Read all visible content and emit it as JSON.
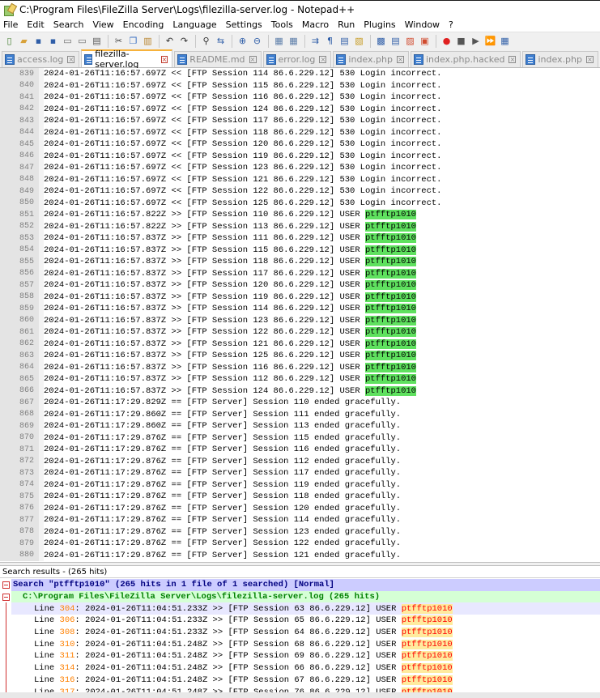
{
  "window": {
    "title": "C:\\Program Files\\FileZilla Server\\Logs\\filezilla-server.log - Notepad++"
  },
  "menu": [
    "File",
    "Edit",
    "Search",
    "View",
    "Encoding",
    "Language",
    "Settings",
    "Tools",
    "Macro",
    "Run",
    "Plugins",
    "Window",
    "?"
  ],
  "tabs": [
    {
      "label": "access.log",
      "active": false
    },
    {
      "label": "filezilla-server.log",
      "active": true
    },
    {
      "label": "README.md",
      "active": false
    },
    {
      "label": "error.log",
      "active": false
    },
    {
      "label": "index.php",
      "active": false
    },
    {
      "label": "index.php.hacked",
      "active": false
    },
    {
      "label": "index.php",
      "active": false
    }
  ],
  "editor": {
    "lines": [
      {
        "n": "839",
        "text": "2024-01-26T11:16:57.697Z << [FTP Session 114 86.6.229.12] 530 Login incorrect.",
        "hit": ""
      },
      {
        "n": "840",
        "text": "2024-01-26T11:16:57.697Z << [FTP Session 115 86.6.229.12] 530 Login incorrect.",
        "hit": ""
      },
      {
        "n": "841",
        "text": "2024-01-26T11:16:57.697Z << [FTP Session 116 86.6.229.12] 530 Login incorrect.",
        "hit": ""
      },
      {
        "n": "842",
        "text": "2024-01-26T11:16:57.697Z << [FTP Session 124 86.6.229.12] 530 Login incorrect.",
        "hit": ""
      },
      {
        "n": "843",
        "text": "2024-01-26T11:16:57.697Z << [FTP Session 117 86.6.229.12] 530 Login incorrect.",
        "hit": ""
      },
      {
        "n": "844",
        "text": "2024-01-26T11:16:57.697Z << [FTP Session 118 86.6.229.12] 530 Login incorrect.",
        "hit": ""
      },
      {
        "n": "845",
        "text": "2024-01-26T11:16:57.697Z << [FTP Session 120 86.6.229.12] 530 Login incorrect.",
        "hit": ""
      },
      {
        "n": "846",
        "text": "2024-01-26T11:16:57.697Z << [FTP Session 119 86.6.229.12] 530 Login incorrect.",
        "hit": ""
      },
      {
        "n": "847",
        "text": "2024-01-26T11:16:57.697Z << [FTP Session 123 86.6.229.12] 530 Login incorrect.",
        "hit": ""
      },
      {
        "n": "848",
        "text": "2024-01-26T11:16:57.697Z << [FTP Session 121 86.6.229.12] 530 Login incorrect.",
        "hit": ""
      },
      {
        "n": "849",
        "text": "2024-01-26T11:16:57.697Z << [FTP Session 122 86.6.229.12] 530 Login incorrect.",
        "hit": ""
      },
      {
        "n": "850",
        "text": "2024-01-26T11:16:57.697Z << [FTP Session 125 86.6.229.12] 530 Login incorrect.",
        "hit": ""
      },
      {
        "n": "851",
        "text": "2024-01-26T11:16:57.822Z >> [FTP Session 110 86.6.229.12] USER ",
        "hit": "ptfftp1010"
      },
      {
        "n": "852",
        "text": "2024-01-26T11:16:57.822Z >> [FTP Session 113 86.6.229.12] USER ",
        "hit": "ptfftp1010"
      },
      {
        "n": "853",
        "text": "2024-01-26T11:16:57.837Z >> [FTP Session 111 86.6.229.12] USER ",
        "hit": "ptfftp1010"
      },
      {
        "n": "854",
        "text": "2024-01-26T11:16:57.837Z >> [FTP Session 115 86.6.229.12] USER ",
        "hit": "ptfftp1010"
      },
      {
        "n": "855",
        "text": "2024-01-26T11:16:57.837Z >> [FTP Session 118 86.6.229.12] USER ",
        "hit": "ptfftp1010"
      },
      {
        "n": "856",
        "text": "2024-01-26T11:16:57.837Z >> [FTP Session 117 86.6.229.12] USER ",
        "hit": "ptfftp1010"
      },
      {
        "n": "857",
        "text": "2024-01-26T11:16:57.837Z >> [FTP Session 120 86.6.229.12] USER ",
        "hit": "ptfftp1010"
      },
      {
        "n": "858",
        "text": "2024-01-26T11:16:57.837Z >> [FTP Session 119 86.6.229.12] USER ",
        "hit": "ptfftp1010"
      },
      {
        "n": "859",
        "text": "2024-01-26T11:16:57.837Z >> [FTP Session 114 86.6.229.12] USER ",
        "hit": "ptfftp1010"
      },
      {
        "n": "860",
        "text": "2024-01-26T11:16:57.837Z >> [FTP Session 123 86.6.229.12] USER ",
        "hit": "ptfftp1010"
      },
      {
        "n": "861",
        "text": "2024-01-26T11:16:57.837Z >> [FTP Session 122 86.6.229.12] USER ",
        "hit": "ptfftp1010"
      },
      {
        "n": "862",
        "text": "2024-01-26T11:16:57.837Z >> [FTP Session 121 86.6.229.12] USER ",
        "hit": "ptfftp1010"
      },
      {
        "n": "863",
        "text": "2024-01-26T11:16:57.837Z >> [FTP Session 125 86.6.229.12] USER ",
        "hit": "ptfftp1010"
      },
      {
        "n": "864",
        "text": "2024-01-26T11:16:57.837Z >> [FTP Session 116 86.6.229.12] USER ",
        "hit": "ptfftp1010"
      },
      {
        "n": "865",
        "text": "2024-01-26T11:16:57.837Z >> [FTP Session 112 86.6.229.12] USER ",
        "hit": "ptfftp1010"
      },
      {
        "n": "866",
        "text": "2024-01-26T11:16:57.837Z >> [FTP Session 124 86.6.229.12] USER ",
        "hit": "ptfftp1010"
      },
      {
        "n": "867",
        "text": "2024-01-26T11:17:29.829Z == [FTP Server] Session 110 ended gracefully.",
        "hit": ""
      },
      {
        "n": "868",
        "text": "2024-01-26T11:17:29.860Z == [FTP Server] Session 111 ended gracefully.",
        "hit": ""
      },
      {
        "n": "869",
        "text": "2024-01-26T11:17:29.860Z == [FTP Server] Session 113 ended gracefully.",
        "hit": ""
      },
      {
        "n": "870",
        "text": "2024-01-26T11:17:29.876Z == [FTP Server] Session 115 ended gracefully.",
        "hit": ""
      },
      {
        "n": "871",
        "text": "2024-01-26T11:17:29.876Z == [FTP Server] Session 116 ended gracefully.",
        "hit": ""
      },
      {
        "n": "872",
        "text": "2024-01-26T11:17:29.876Z == [FTP Server] Session 112 ended gracefully.",
        "hit": ""
      },
      {
        "n": "873",
        "text": "2024-01-26T11:17:29.876Z == [FTP Server] Session 117 ended gracefully.",
        "hit": ""
      },
      {
        "n": "874",
        "text": "2024-01-26T11:17:29.876Z == [FTP Server] Session 119 ended gracefully.",
        "hit": ""
      },
      {
        "n": "875",
        "text": "2024-01-26T11:17:29.876Z == [FTP Server] Session 118 ended gracefully.",
        "hit": ""
      },
      {
        "n": "876",
        "text": "2024-01-26T11:17:29.876Z == [FTP Server] Session 120 ended gracefully.",
        "hit": ""
      },
      {
        "n": "877",
        "text": "2024-01-26T11:17:29.876Z == [FTP Server] Session 114 ended gracefully.",
        "hit": ""
      },
      {
        "n": "878",
        "text": "2024-01-26T11:17:29.876Z == [FTP Server] Session 123 ended gracefully.",
        "hit": ""
      },
      {
        "n": "879",
        "text": "2024-01-26T11:17:29.876Z == [FTP Server] Session 122 ended gracefully.",
        "hit": ""
      },
      {
        "n": "880",
        "text": "2024-01-26T11:17:29.876Z == [FTP Server] Session 121 ended gracefully.",
        "hit": ""
      }
    ]
  },
  "results_panel": {
    "title": "Search results - (265 hits)",
    "search_header": "Search \"ptfftp1010\" (265 hits in 1 file of 1 searched) [Normal]",
    "file_header": "C:\\Program Files\\FileZilla Server\\Logs\\filezilla-server.log (265 hits)",
    "hits": [
      {
        "line": "304",
        "text": "2024-01-26T11:04:51.233Z >> [FTP Session 63 86.6.229.12] USER ",
        "match": "ptfftp1010"
      },
      {
        "line": "306",
        "text": "2024-01-26T11:04:51.233Z >> [FTP Session 65 86.6.229.12] USER ",
        "match": "ptfftp1010"
      },
      {
        "line": "308",
        "text": "2024-01-26T11:04:51.233Z >> [FTP Session 64 86.6.229.12] USER ",
        "match": "ptfftp1010"
      },
      {
        "line": "310",
        "text": "2024-01-26T11:04:51.248Z >> [FTP Session 68 86.6.229.12] USER ",
        "match": "ptfftp1010"
      },
      {
        "line": "311",
        "text": "2024-01-26T11:04:51.248Z >> [FTP Session 69 86.6.229.12] USER ",
        "match": "ptfftp1010"
      },
      {
        "line": "314",
        "text": "2024-01-26T11:04:51.248Z >> [FTP Session 66 86.6.229.12] USER ",
        "match": "ptfftp1010"
      },
      {
        "line": "316",
        "text": "2024-01-26T11:04:51.248Z >> [FTP Session 67 86.6.229.12] USER ",
        "match": "ptfftp1010"
      },
      {
        "line": "317",
        "text": "2024-01-26T11:04:51.248Z >> [FTP Session 76 86.6.229.12] USER ",
        "match": "ptfftp1010"
      }
    ]
  },
  "colors": {
    "highlight_green": "#5fe15f",
    "search_header_bg": "#ccccff",
    "file_header_bg": "#d5ffd5",
    "hit_text": "#ff0000",
    "line_number": "#ff8000",
    "active_tab_accent": "#f7b23b"
  },
  "toolbar_icons": [
    "new-file-icon",
    "open-file-icon",
    "save-icon",
    "save-all-icon",
    "close-icon",
    "close-all-icon",
    "print-icon",
    "cut-icon",
    "copy-icon",
    "paste-icon",
    "undo-icon",
    "redo-icon",
    "find-icon",
    "replace-icon",
    "zoom-in-icon",
    "zoom-out-icon",
    "sync-vertical-icon",
    "sync-horizontal-icon",
    "word-wrap-icon",
    "show-all-chars-icon",
    "indent-guide-icon",
    "udl-icon",
    "doc-map-icon",
    "function-list-icon",
    "folder-workspace-icon",
    "doc-monitor-icon",
    "record-macro-icon",
    "stop-macro-icon",
    "play-macro-icon",
    "run-macro-multiple-icon",
    "save-macro-icon"
  ]
}
